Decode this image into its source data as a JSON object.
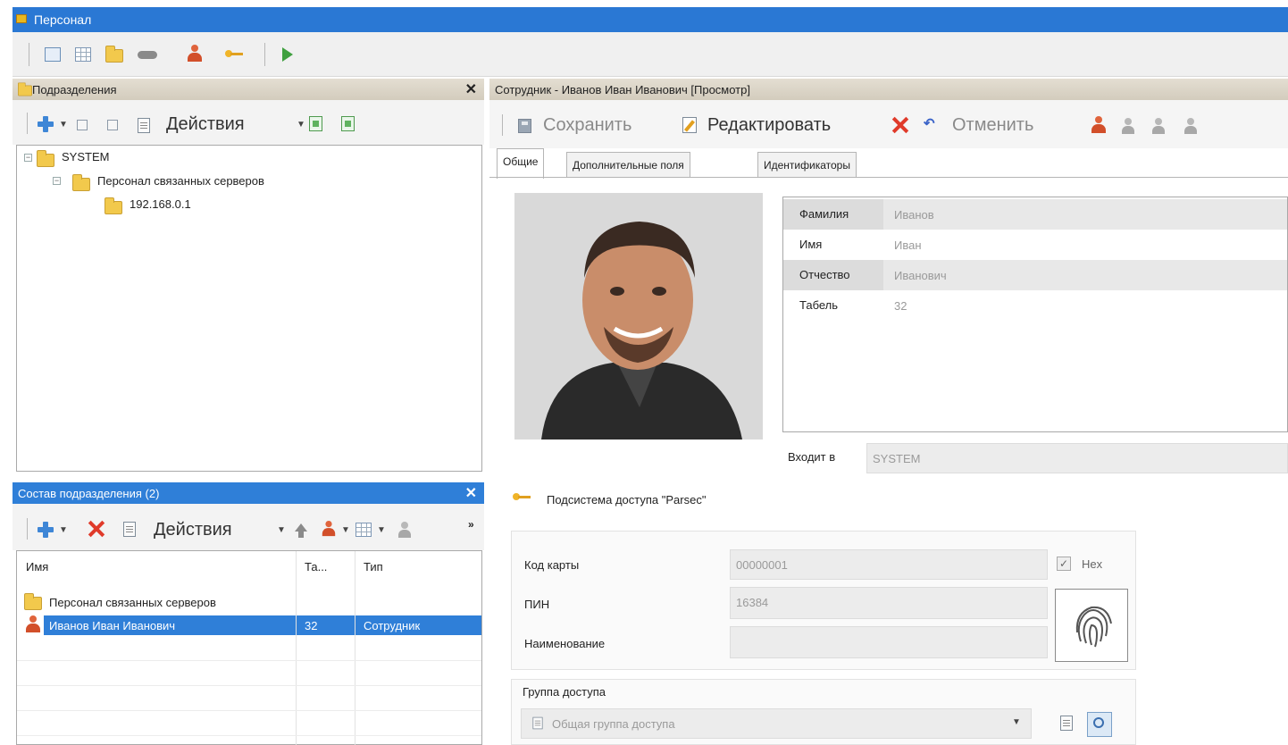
{
  "window": {
    "title": "Персонал"
  },
  "main_toolbar": {
    "icons": [
      "form-icon",
      "grid-icon",
      "folder-icon",
      "cloud-icon",
      "person-icon",
      "key-icon",
      "arrow-icon"
    ]
  },
  "departments_panel": {
    "title": "Подразделения",
    "actions_label": "Действия",
    "tree": [
      {
        "label": "SYSTEM",
        "level": 0,
        "expanded": true
      },
      {
        "label": "Персонал связанных серверов",
        "level": 1,
        "expanded": true
      },
      {
        "label": "192.168.0.1",
        "level": 2
      }
    ]
  },
  "composition_panel": {
    "title": "Состав подразделения (2)",
    "actions_label": "Действия",
    "overflow_label": "»",
    "columns": [
      "Имя",
      "Та...",
      "Тип"
    ],
    "rows": [
      {
        "name": "Персонал связанных серверов",
        "tab": "",
        "type": "",
        "selected": false
      },
      {
        "name": "Иванов Иван Иванович",
        "tab": "32",
        "type": "Сотрудник",
        "selected": true
      }
    ]
  },
  "employee_panel": {
    "title": "Сотрудник - Иванов Иван Иванович [Просмотр]",
    "toolbar": {
      "save_label": "Сохранить",
      "edit_label": "Редактировать",
      "cancel_label": "Отменить"
    },
    "tabs": [
      "Общие",
      "Дополнительные поля",
      "Идентификаторы"
    ],
    "active_tab": "Общие",
    "fields": [
      {
        "key": "Фамилия",
        "value": "Иванов"
      },
      {
        "key": "Имя",
        "value": "Иван"
      },
      {
        "key": "Отчество",
        "value": "Иванович"
      },
      {
        "key": "Табель",
        "value": "32"
      }
    ],
    "member_of_label": "Входит в",
    "member_of_value": "SYSTEM",
    "access_subsystem_label": "Подсистема доступа \"Parsec\"",
    "card_code_label": "Код карты",
    "card_code_value": "00000001",
    "hex_label": "Hex",
    "hex_checked": true,
    "pin_label": "ПИН",
    "pin_value": "16384",
    "name_label": "Наименование",
    "name_value": "",
    "access_group_label": "Группа доступа",
    "access_group_value": "Общая группа доступа"
  },
  "colors": {
    "titlebar": "#2a78d4",
    "selection": "#2f7fd8",
    "delete_red": "#e03a2a"
  }
}
